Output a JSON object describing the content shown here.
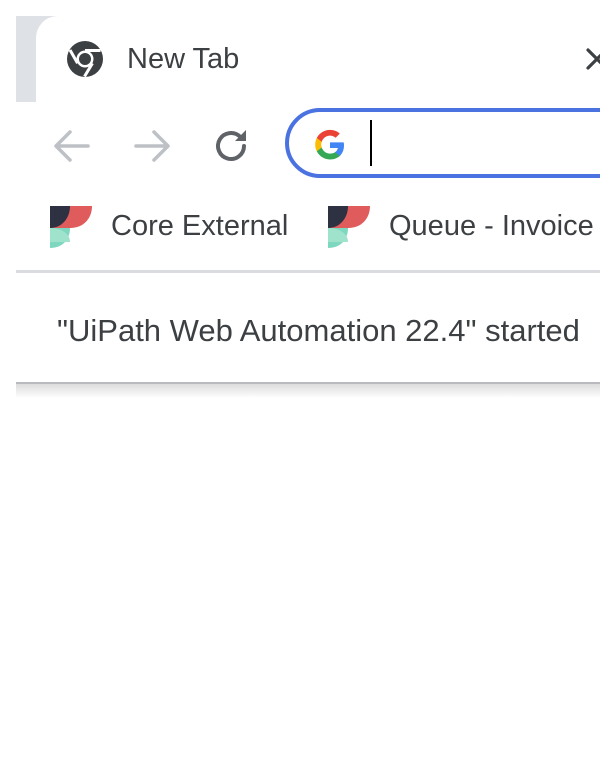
{
  "tab": {
    "title": "New Tab",
    "favicon": "chrome-icon"
  },
  "toolbar": {
    "back_icon": "arrow-left-icon",
    "forward_icon": "arrow-right-icon",
    "reload_icon": "reload-icon",
    "omnibox": {
      "icon": "google-g-icon",
      "value": "",
      "accent_color": "#4a72e0"
    }
  },
  "bookmarks": [
    {
      "label": "Core External",
      "icon": "uipath-bookmark-icon"
    },
    {
      "label": "Queue - Invoice",
      "icon": "uipath-bookmark-icon"
    }
  ],
  "infobar": {
    "message": "\"UiPath Web Automation 22.4\" started"
  },
  "colors": {
    "tab_strip": "#dee1e6",
    "text": "#3c4043",
    "inactive_nav": "#bdc1c6",
    "active_nav": "#5f6368"
  }
}
